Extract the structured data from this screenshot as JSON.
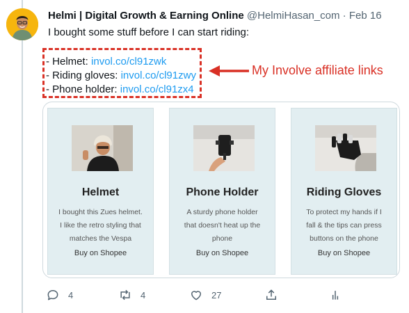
{
  "tweet": {
    "author_name": "Helmi | Digital Growth & Earning Online",
    "handle": "@HelmiHasan_com",
    "separator": "·",
    "date": "Feb 16",
    "text": "I bought some stuff before I can start riding:",
    "link_lines": [
      {
        "label": "- Helmet: ",
        "url": "invol.co/cl91zwk"
      },
      {
        "label": "- Riding gloves: ",
        "url": "invol.co/cl91zwy"
      },
      {
        "label": "- Phone holder: ",
        "url": "invol.co/cl91zx4"
      }
    ],
    "annotation": "My Involve affiliate links"
  },
  "cards": [
    {
      "title": "Helmet",
      "desc_lines": [
        "I bought this Zues helmet.",
        "I like the retro styling that",
        "matches the Vespa"
      ],
      "cta": "Buy on Shopee"
    },
    {
      "title": "Phone Holder",
      "desc_lines": [
        "A sturdy phone holder",
        "that doesn't heat up the",
        "phone"
      ],
      "cta": "Buy on Shopee"
    },
    {
      "title": "Riding Gloves",
      "desc_lines": [
        "To protect my hands if I",
        "fall & the tips can press",
        "buttons on the phone"
      ],
      "cta": "Buy on Shopee"
    }
  ],
  "actions": {
    "replies": "4",
    "retweets": "4",
    "likes": "27"
  },
  "colors": {
    "link": "#1d9bf0",
    "annotation": "#d93025",
    "card_bg": "#e2eef1",
    "muted": "#536471"
  }
}
